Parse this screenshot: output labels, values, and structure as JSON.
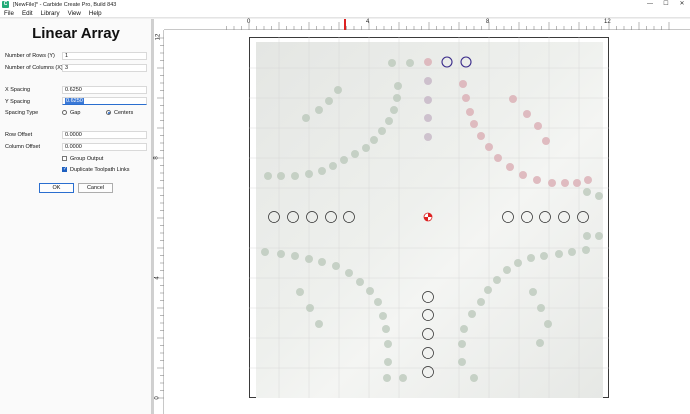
{
  "window": {
    "title": "[NewFile]* - Carbide Create Pro, Build 843",
    "app_icon_glyph": "C",
    "controls": [
      "—",
      "☐",
      "✕"
    ]
  },
  "menu": [
    "File",
    "Edit",
    "Library",
    "View",
    "Help"
  ],
  "panel": {
    "title": "Linear Array",
    "rows_label": "Number of Rows (Y)",
    "rows_value": "1",
    "cols_label": "Number of Columns (X)",
    "cols_value": "3",
    "x_spacing_label": "X Spacing",
    "x_spacing_value": "0.6250",
    "y_spacing_label": "Y Spacing",
    "y_spacing_value": "0.6250",
    "spacing_type_label": "Spacing Type",
    "spacing_gap_label": "Gap",
    "spacing_centers_label": "Centers",
    "spacing_selected": "Centers",
    "row_offset_label": "Row Offset",
    "row_offset_value": "0.0000",
    "col_offset_label": "Column Offset",
    "col_offset_value": "0.0000",
    "group_output_label": "Group Output",
    "group_output_checked": false,
    "duplicate_links_label": "Duplicate Toolpath Links",
    "duplicate_links_checked": true,
    "ok_label": "OK",
    "cancel_label": "Cancel"
  },
  "rulers": {
    "horizontal": [
      "0",
      "4",
      "8",
      "12"
    ],
    "vertical": [
      "12",
      "8",
      "4",
      "0"
    ]
  },
  "colors": {
    "accent": "#2a6ecf",
    "cursor_marker": "#d22",
    "origin_marker": "#d22",
    "selected_circle": "#3a2b8a"
  }
}
